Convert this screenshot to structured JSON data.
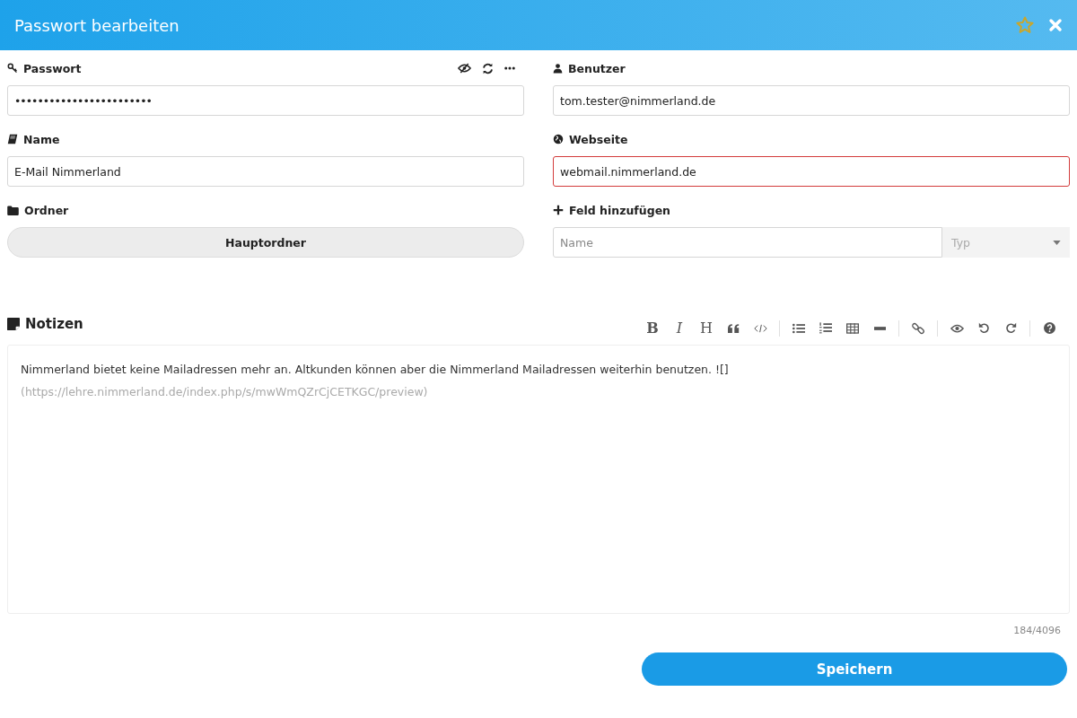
{
  "window": {
    "title": "Passwort bearbeiten",
    "favorite": false
  },
  "fields": [
    {
      "kind": "password",
      "label": "Passwort",
      "value": "••••••••••••••••••••••••",
      "invalid": false
    },
    {
      "kind": "text",
      "label": "Benutzer",
      "value": "tom.tester@nimmerland.de",
      "invalid": false
    },
    {
      "kind": "text",
      "label": "Name",
      "value": "E-Mail Nimmerland",
      "invalid": false
    },
    {
      "kind": "text",
      "label": "Webseite",
      "value": "webmail.nimmerland.de",
      "invalid": true
    },
    {
      "kind": "folder",
      "label": "Ordner",
      "value": "Hauptordner"
    },
    {
      "kind": "custom",
      "label": "Feld hinzufügen",
      "placeholder": "Name",
      "type_placeholder": "Typ"
    }
  ],
  "notes": {
    "label": "Notizen",
    "toolbar": [
      [
        {
          "kind": "bold",
          "label": "B"
        },
        {
          "kind": "italic",
          "label": "I"
        },
        {
          "kind": "heading",
          "label": "H"
        },
        {
          "kind": "quote"
        },
        {
          "kind": "code"
        }
      ],
      [
        {
          "kind": "bullets"
        },
        {
          "kind": "numbers"
        },
        {
          "kind": "table"
        },
        {
          "kind": "rule"
        }
      ],
      [
        {
          "kind": "link"
        }
      ],
      [
        {
          "kind": "preview"
        },
        {
          "kind": "undo"
        },
        {
          "kind": "redo"
        }
      ],
      [
        {
          "kind": "help"
        }
      ]
    ],
    "text": "Nimmerland bietet keine Mailadressen mehr an. Altkunden können aber die Nimmerland Mailadressen weiterhin benutzen. ![]",
    "link": "(https://lehre.nimmerland.de/index.php/s/mwWmQZrCjCETKGC/preview)",
    "counter": "184/4096"
  },
  "save_button": "Speichern"
}
